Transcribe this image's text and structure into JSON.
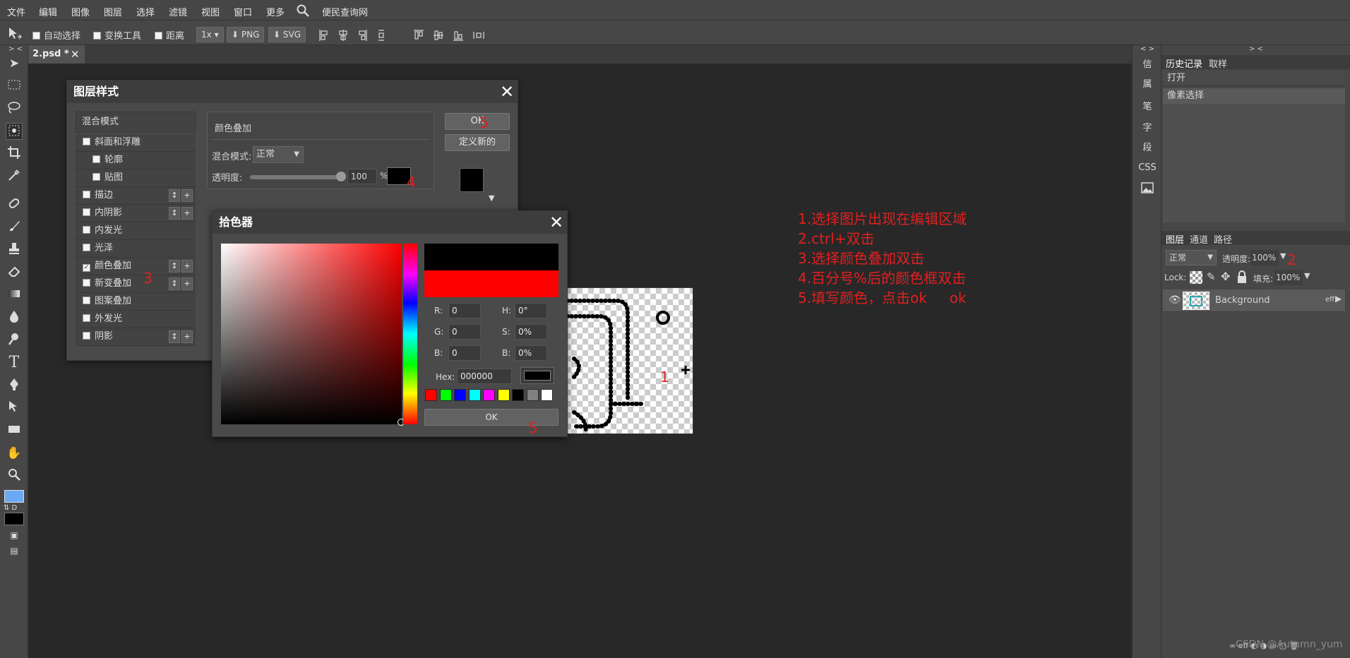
{
  "menubar": {
    "items": [
      "文件",
      "编辑",
      "图像",
      "图层",
      "选择",
      "滤镜",
      "视图",
      "窗口",
      "更多"
    ],
    "site_link": "便民查询网"
  },
  "optionsbar": {
    "auto_select": "自动选择",
    "transform_tool": "变换工具",
    "distance": "距离",
    "zoom": "1x",
    "png": "PNG",
    "svg": "SVG"
  },
  "document_tab": {
    "label": "2.psd *"
  },
  "right_sidebar": {
    "collapse": "< >",
    "items": [
      "信",
      "属",
      "笔",
      "字",
      "段",
      "CSS"
    ]
  },
  "panels": {
    "collapse": "> <",
    "history_tabs": [
      "历史记录",
      "取样"
    ],
    "history_items": [
      "打开",
      "像素选择"
    ],
    "layer_tabs": [
      "图层",
      "通道",
      "路径"
    ],
    "blend_mode": "正常",
    "opacity_label": "透明度:",
    "opacity_value": "100%",
    "lock_label": "Lock:",
    "fill_label": "填充:",
    "fill_value": "100%",
    "layer_name": "Background",
    "layer_eff": "eff"
  },
  "layer_style_dialog": {
    "title": "图层样式",
    "blend_header": "混合模式",
    "effects": [
      {
        "label": "斜面和浮雕",
        "checked": false,
        "indent": false,
        "controls": false
      },
      {
        "label": "轮廓",
        "checked": false,
        "indent": true,
        "controls": false
      },
      {
        "label": "贴图",
        "checked": false,
        "indent": true,
        "controls": false
      },
      {
        "label": "描边",
        "checked": false,
        "indent": false,
        "controls": true
      },
      {
        "label": "内阴影",
        "checked": false,
        "indent": false,
        "controls": true
      },
      {
        "label": "内发光",
        "checked": false,
        "indent": false,
        "controls": false
      },
      {
        "label": "光泽",
        "checked": false,
        "indent": false,
        "controls": false
      },
      {
        "label": "颜色叠加",
        "checked": true,
        "indent": false,
        "controls": true
      },
      {
        "label": "新变叠加",
        "checked": false,
        "indent": false,
        "controls": true
      },
      {
        "label": "图案叠加",
        "checked": false,
        "indent": false,
        "controls": false
      },
      {
        "label": "外发光",
        "checked": false,
        "indent": false,
        "controls": false
      },
      {
        "label": "阴影",
        "checked": false,
        "indent": false,
        "controls": true
      }
    ],
    "section_title": "颜色叠加",
    "blend_mode_label": "混合模式:",
    "blend_mode_value": "正常",
    "opacity_label": "透明度:",
    "opacity_value": "100",
    "percent": "%",
    "overlay_color": "#000000",
    "ok": "OK",
    "new_style": "定义新的"
  },
  "color_picker": {
    "title": "拾色器",
    "old_color": "#000000",
    "new_color": "#ff0000",
    "fields": {
      "r_label": "R:",
      "r": "0",
      "g_label": "G:",
      "g": "0",
      "b_label": "B:",
      "b": "0",
      "h_label": "H:",
      "h": "0°",
      "s_label": "S:",
      "s": "0%",
      "v_label": "B:",
      "v": "0%",
      "hex_label": "Hex:",
      "hex": "000000"
    },
    "swatches": [
      "#ff0000",
      "#00ff00",
      "#0000ff",
      "#00ffff",
      "#ff00ff",
      "#ffff00",
      "#000000",
      "#808080",
      "#ffffff"
    ],
    "ok": "OK"
  },
  "annotations": {
    "n1": "1",
    "n2": "2",
    "n3": "3",
    "n4": "4",
    "n5": "5",
    "n5b": "5"
  },
  "instructions": [
    "1.选择图片出现在编辑区域",
    "2.ctrl+双击",
    "3.选择颜色叠加双击",
    "4.百分号%后的颜色框双击",
    "5.填写颜色，点击ok     ok"
  ],
  "watermark": "CSDN @Autumn_yum"
}
